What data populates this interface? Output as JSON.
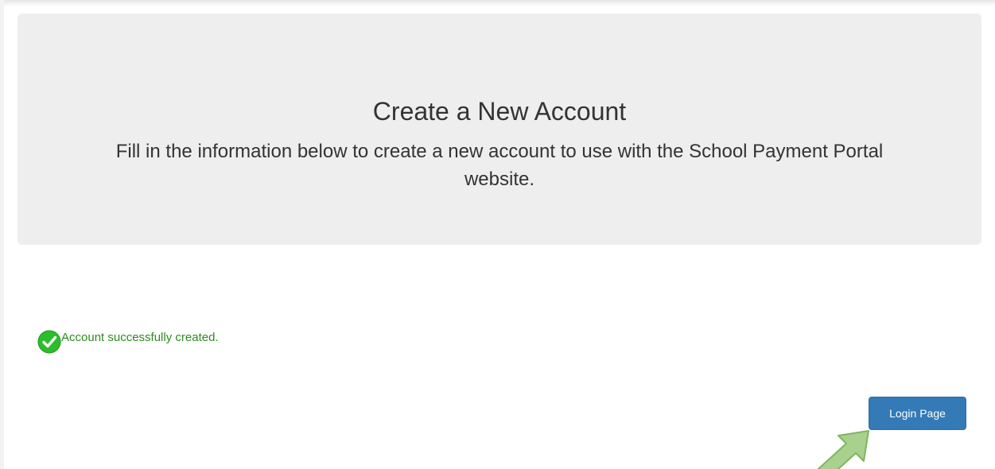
{
  "header": {
    "title": "Create a New Account",
    "description": "Fill in the information below to create a new account to use with the School Payment Portal website."
  },
  "alert": {
    "icon": "check-circle-icon",
    "message": "Account successfully created.",
    "color": "#2e8b1e"
  },
  "actions": {
    "login_label": "Login Page",
    "button_color": "#337ab7"
  },
  "annotation": {
    "icon": "arrow-pointer-icon",
    "color": "#a9d18e"
  }
}
